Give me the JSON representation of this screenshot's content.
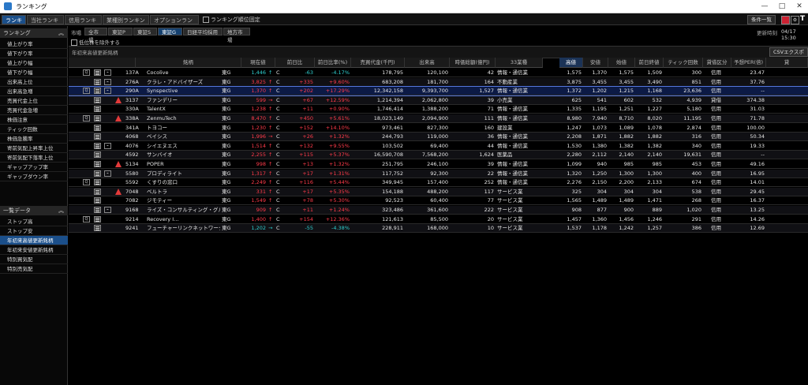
{
  "window": {
    "title": "ランキング",
    "minimize": "—",
    "maximize": "□",
    "close": "✕"
  },
  "tabs": [
    {
      "label": "ランキング",
      "active": true
    },
    {
      "label": "当社ランキング",
      "active": false
    },
    {
      "label": "信用ランキング",
      "active": false
    },
    {
      "label": "業種別ランキング",
      "active": false
    },
    {
      "label": "オプションランキング",
      "active": false
    }
  ],
  "fix_label": "ランキング順位固定",
  "top_right": {
    "list_button": "条件一覧"
  },
  "sidebar": {
    "ranking_header": "ランキング",
    "items": [
      "値上がり率",
      "値下がり率",
      "値上がり幅",
      "値下がり幅",
      "出来高上位",
      "出来高急増",
      "売買代金上位",
      "売買代金急増",
      "株価注意",
      "ティック回数",
      "株価急騰率",
      "寄前気配上昇率上位",
      "寄前気配下落率上位",
      "ギャップアップ率",
      "ギャップダウン率"
    ],
    "list_header": "一覧データ",
    "list_items": [
      "ストップ高",
      "ストップ安",
      "年初来高値更新銘柄",
      "年初来安値更新銘柄",
      "特別買気配",
      "特別売気配"
    ],
    "selected_list_index": 2
  },
  "main": {
    "market_label": "市場",
    "market_tabs": [
      {
        "label": "全市場",
        "active": false
      },
      {
        "label": "東証P",
        "active": false
      },
      {
        "label": "東証S",
        "active": false
      },
      {
        "label": "東証G",
        "active": true
      },
      {
        "label": "日経平均採用",
        "active": false
      },
      {
        "label": "地方市場",
        "active": false
      }
    ],
    "update_label": "更新時刻",
    "update_time": "04/17 15:30",
    "exclude_label": "低位株を除外する",
    "list_title": "年初来高値更新銘柄",
    "csv_button": "CSVエクスポート"
  },
  "table": {
    "columns": [
      "銘柄",
      "現在値",
      "前日比",
      "前日比率(%)",
      "売買代金(千円)",
      "出来高",
      "時価総額(億円)",
      "33業種",
      "高値",
      "安値",
      "始値",
      "前日終値",
      "ティック回数",
      "貸借区分",
      "予想PER(倍)",
      "貸"
    ],
    "sorted_column": "高値",
    "rows": [
      {
        "q": true,
        "chart": true,
        "warn": false,
        "code": "137A",
        "name": "Cocolive",
        "mkt": "東G",
        "price": "1,446",
        "arrow": "↑",
        "flag": "C",
        "chg": "-63",
        "pct": "-4.17%",
        "dir": "dn",
        "value": "178,795",
        "vol": "120,100",
        "cap": "42",
        "ind": "情報・通信業",
        "high": "1,575",
        "low": "1,370",
        "open": "1,575",
        "prev": "1,509",
        "tick": "300",
        "kind": "信用",
        "per": "23.47"
      },
      {
        "q": false,
        "chart": true,
        "warn": false,
        "code": "276A",
        "name": "クラレ・アドバイザーズ",
        "mkt": "東G",
        "price": "3,825",
        "arrow": "↑",
        "flag": "C",
        "chg": "+335",
        "pct": "+9.60%",
        "dir": "up",
        "value": "683,208",
        "vol": "181,700",
        "cap": "164",
        "ind": "不動産業",
        "high": "3,875",
        "low": "3,455",
        "open": "3,455",
        "prev": "3,490",
        "tick": "851",
        "kind": "信用",
        "per": "37.76"
      },
      {
        "q": true,
        "chart": true,
        "warn": false,
        "code": "290A",
        "name": "Synspective",
        "mkt": "東G",
        "price": "1,370",
        "arrow": "↑",
        "flag": "C",
        "chg": "+202",
        "pct": "+17.29%",
        "dir": "up",
        "value": "12,342,158",
        "vol": "9,393,700",
        "cap": "1,527",
        "ind": "情報・通信業",
        "high": "1,372",
        "low": "1,202",
        "open": "1,215",
        "prev": "1,168",
        "tick": "23,636",
        "kind": "信用",
        "per": "--",
        "sel": true
      },
      {
        "q": false,
        "chart": false,
        "warn": true,
        "code": "3137",
        "name": "ファンデリー",
        "mkt": "東G",
        "price": "599",
        "arrow": "→",
        "flag": "C",
        "chg": "+67",
        "pct": "+12.59%",
        "dir": "up",
        "value": "1,214,394",
        "vol": "2,062,800",
        "cap": "39",
        "ind": "小売業",
        "high": "625",
        "low": "541",
        "open": "602",
        "prev": "532",
        "tick": "4,939",
        "kind": "貸借",
        "per": "374.38"
      },
      {
        "q": false,
        "chart": false,
        "warn": false,
        "code": "330A",
        "name": "TalentX",
        "mkt": "東G",
        "price": "1,238",
        "arrow": "↑",
        "flag": "C",
        "chg": "+11",
        "pct": "+0.90%",
        "dir": "up",
        "value": "1,746,414",
        "vol": "1,388,200",
        "cap": "71",
        "ind": "情報・通信業",
        "high": "1,335",
        "low": "1,195",
        "open": "1,251",
        "prev": "1,227",
        "tick": "5,180",
        "kind": "信用",
        "per": "31.03"
      },
      {
        "q": true,
        "chart": false,
        "warn": true,
        "code": "338A",
        "name": "ZenmuTech",
        "mkt": "東G",
        "price": "8,470",
        "arrow": "↑",
        "flag": "C",
        "chg": "+450",
        "pct": "+5.61%",
        "dir": "up",
        "value": "18,023,149",
        "vol": "2,094,900",
        "cap": "111",
        "ind": "情報・通信業",
        "high": "8,980",
        "low": "7,940",
        "open": "8,710",
        "prev": "8,020",
        "tick": "11,195",
        "kind": "信用",
        "per": "71.78"
      },
      {
        "q": false,
        "chart": false,
        "warn": false,
        "code": "341A",
        "name": "トヨコー",
        "mkt": "東G",
        "price": "1,230",
        "arrow": "↑",
        "flag": "C",
        "chg": "+152",
        "pct": "+14.10%",
        "dir": "up",
        "value": "973,461",
        "vol": "827,300",
        "cap": "160",
        "ind": "建設業",
        "high": "1,247",
        "low": "1,073",
        "open": "1,089",
        "prev": "1,078",
        "tick": "2,874",
        "kind": "信用",
        "per": "100.00"
      },
      {
        "q": false,
        "chart": false,
        "warn": false,
        "code": "4068",
        "name": "ベイシス",
        "mkt": "東G",
        "price": "1,996",
        "arrow": "→",
        "flag": "C",
        "chg": "+26",
        "pct": "+1.32%",
        "dir": "up",
        "value": "244,793",
        "vol": "119,000",
        "cap": "36",
        "ind": "情報・通信業",
        "high": "2,208",
        "low": "1,871",
        "open": "1,882",
        "prev": "1,882",
        "tick": "316",
        "kind": "信用",
        "per": "50.34"
      },
      {
        "q": false,
        "chart": true,
        "warn": false,
        "code": "4076",
        "name": "シイエヌエス",
        "mkt": "東G",
        "price": "1,514",
        "arrow": "↑",
        "flag": "C",
        "chg": "+132",
        "pct": "+9.55%",
        "dir": "up",
        "value": "103,502",
        "vol": "69,400",
        "cap": "44",
        "ind": "情報・通信業",
        "high": "1,530",
        "low": "1,380",
        "open": "1,382",
        "prev": "1,382",
        "tick": "340",
        "kind": "信用",
        "per": "19.33"
      },
      {
        "q": false,
        "chart": false,
        "warn": false,
        "code": "4592",
        "name": "サンバイオ",
        "mkt": "東G",
        "price": "2,255",
        "arrow": "↑",
        "flag": "C",
        "chg": "+115",
        "pct": "+5.37%",
        "dir": "up",
        "value": "16,590,708",
        "vol": "7,568,200",
        "cap": "1,624",
        "ind": "医薬品",
        "high": "2,280",
        "low": "2,112",
        "open": "2,140",
        "prev": "2,140",
        "tick": "19,631",
        "kind": "信用",
        "per": "--"
      },
      {
        "q": false,
        "chart": false,
        "warn": true,
        "code": "5134",
        "name": "POPER",
        "mkt": "東G",
        "price": "998",
        "arrow": "↑",
        "flag": "C",
        "chg": "+13",
        "pct": "+1.32%",
        "dir": "up",
        "value": "251,795",
        "vol": "246,100",
        "cap": "39",
        "ind": "情報・通信業",
        "high": "1,099",
        "low": "940",
        "open": "985",
        "prev": "985",
        "tick": "453",
        "kind": "信用",
        "per": "49.16"
      },
      {
        "q": false,
        "chart": true,
        "warn": false,
        "code": "5580",
        "name": "プロディライト",
        "mkt": "東G",
        "price": "1,317",
        "arrow": "↑",
        "flag": "C",
        "chg": "+17",
        "pct": "+1.31%",
        "dir": "up",
        "value": "117,752",
        "vol": "92,300",
        "cap": "22",
        "ind": "情報・通信業",
        "high": "1,320",
        "low": "1,250",
        "open": "1,300",
        "prev": "1,300",
        "tick": "400",
        "kind": "信用",
        "per": "16.95"
      },
      {
        "q": true,
        "chart": false,
        "warn": false,
        "code": "5592",
        "name": "くすりの窓口",
        "mkt": "東G",
        "price": "2,249",
        "arrow": "↑",
        "flag": "C",
        "chg": "+116",
        "pct": "+5.44%",
        "dir": "up",
        "value": "349,945",
        "vol": "157,400",
        "cap": "252",
        "ind": "情報・通信業",
        "high": "2,276",
        "low": "2,150",
        "open": "2,200",
        "prev": "2,133",
        "tick": "674",
        "kind": "信用",
        "per": "14.01"
      },
      {
        "q": false,
        "chart": false,
        "warn": true,
        "code": "7048",
        "name": "ベルトラ",
        "mkt": "東G",
        "price": "331",
        "arrow": "↑",
        "flag": "C",
        "chg": "+17",
        "pct": "+5.35%",
        "dir": "up",
        "value": "154,188",
        "vol": "488,200",
        "cap": "117",
        "ind": "サービス業",
        "high": "325",
        "low": "304",
        "open": "304",
        "prev": "304",
        "tick": "538",
        "kind": "信用",
        "per": "29.45"
      },
      {
        "q": false,
        "chart": false,
        "warn": false,
        "code": "7082",
        "name": "ジモティー",
        "mkt": "東G",
        "price": "1,549",
        "arrow": "↑",
        "flag": "C",
        "chg": "+78",
        "pct": "+5.30%",
        "dir": "up",
        "value": "92,523",
        "vol": "60,400",
        "cap": "77",
        "ind": "サービス業",
        "high": "1,565",
        "low": "1,489",
        "open": "1,489",
        "prev": "1,471",
        "tick": "268",
        "kind": "信用",
        "per": "16.37"
      },
      {
        "q": false,
        "chart": true,
        "warn": false,
        "code": "9168",
        "name": "ライズ・コンサルティング・グル…",
        "mkt": "東G",
        "price": "909",
        "arrow": "↑",
        "flag": "C",
        "chg": "+11",
        "pct": "+1.24%",
        "dir": "up",
        "value": "323,486",
        "vol": "361,600",
        "cap": "222",
        "ind": "サービス業",
        "high": "908",
        "low": "877",
        "open": "900",
        "prev": "889",
        "tick": "1,020",
        "kind": "信用",
        "per": "13.25"
      },
      {
        "q": true,
        "chart": false,
        "warn": false,
        "code": "9214",
        "name": "Recovery I…",
        "mkt": "東G",
        "price": "1,400",
        "arrow": "↑",
        "flag": "C",
        "chg": "+154",
        "pct": "+12.36%",
        "dir": "up",
        "value": "121,613",
        "vol": "85,500",
        "cap": "20",
        "ind": "サービス業",
        "high": "1,457",
        "low": "1,360",
        "open": "1,456",
        "prev": "1,246",
        "tick": "291",
        "kind": "信用",
        "per": "14.26"
      },
      {
        "q": false,
        "chart": false,
        "warn": false,
        "code": "9241",
        "name": "フューチャーリンクネットワーク",
        "mkt": "東G",
        "price": "1,202",
        "arrow": "→",
        "flag": "C",
        "chg": "-55",
        "pct": "-4.38%",
        "dir": "dn",
        "value": "228,911",
        "vol": "168,000",
        "cap": "10",
        "ind": "サービス業",
        "high": "1,537",
        "low": "1,178",
        "open": "1,242",
        "prev": "1,257",
        "tick": "386",
        "kind": "信用",
        "per": "12.69"
      }
    ]
  }
}
